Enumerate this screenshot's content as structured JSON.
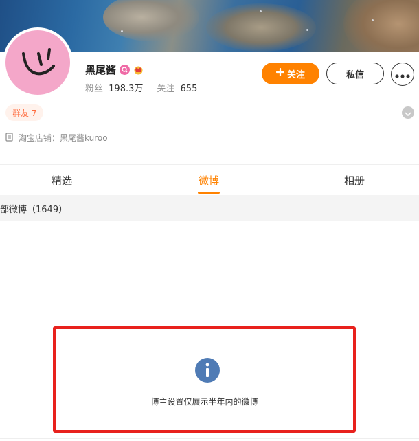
{
  "profile": {
    "name": "黑尾酱",
    "stats": [
      {
        "label": "粉丝",
        "value": "198.3万"
      },
      {
        "label": "关注",
        "value": "655"
      }
    ],
    "group_tag": "群友 7",
    "shop": "淘宝店铺：黑尾酱kuroo"
  },
  "actions": {
    "follow_label": "关注",
    "message_label": "私信"
  },
  "tabs": [
    {
      "label": "精选",
      "active": false
    },
    {
      "label": "微博",
      "active": true
    },
    {
      "label": "相册",
      "active": false
    }
  ],
  "feed": {
    "count_label": "部微博（1649）",
    "notice": "博主设置仅展示半年内的微博"
  },
  "colors": {
    "accent": "#ff8200",
    "highlight_border": "#e8211d",
    "info": "#4f7bb5",
    "avatar_bg": "#f4a7c9"
  },
  "icons": {
    "follow": "plus-icon",
    "more": "ellipsis-icon",
    "expand": "chevron-down-icon",
    "shop": "document-icon",
    "notice": "info-icon"
  }
}
